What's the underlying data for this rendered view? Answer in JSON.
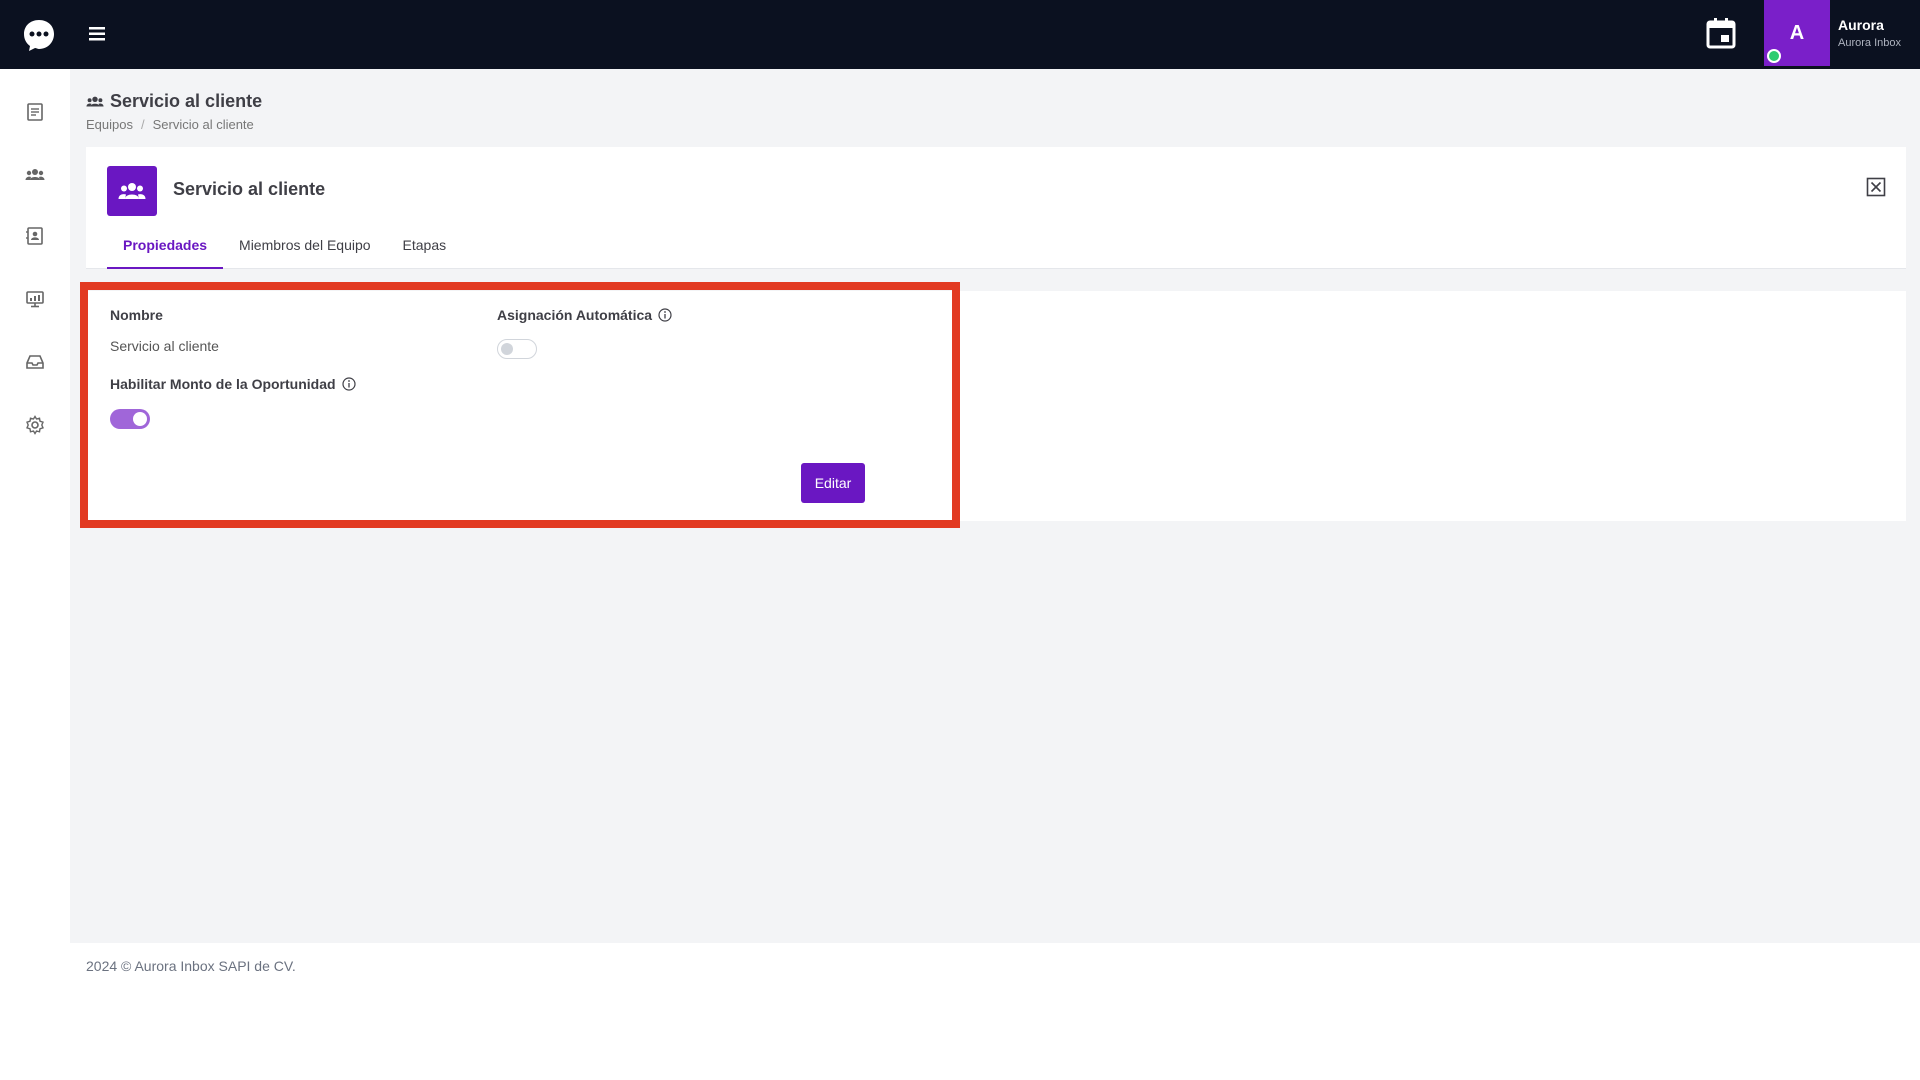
{
  "topbar": {
    "user_initial": "A",
    "user_name": "Aurora",
    "user_org": "Aurora Inbox"
  },
  "page": {
    "title": "Servicio al cliente",
    "breadcrumb": [
      "Equipos",
      "Servicio al cliente"
    ]
  },
  "team": {
    "name": "Servicio al cliente",
    "tabs": [
      {
        "label": "Propiedades",
        "active": true
      },
      {
        "label": "Miembros del Equipo",
        "active": false
      },
      {
        "label": "Etapas",
        "active": false
      }
    ]
  },
  "properties": {
    "name_label": "Nombre",
    "name_value": "Servicio al cliente",
    "auto_assign_label": "Asignación Automática",
    "auto_assign_enabled": false,
    "opportunity_label": "Habilitar Monto de la Oportunidad",
    "opportunity_enabled": true,
    "edit_label": "Editar"
  },
  "footer": {
    "text": "2024 © Aurora Inbox SAPI de CV."
  },
  "colors": {
    "topbar_bg": "#0b1120",
    "brand": "#6a17c2",
    "avatar_bg": "#7a1fc9",
    "highlight": "#e23a22"
  }
}
